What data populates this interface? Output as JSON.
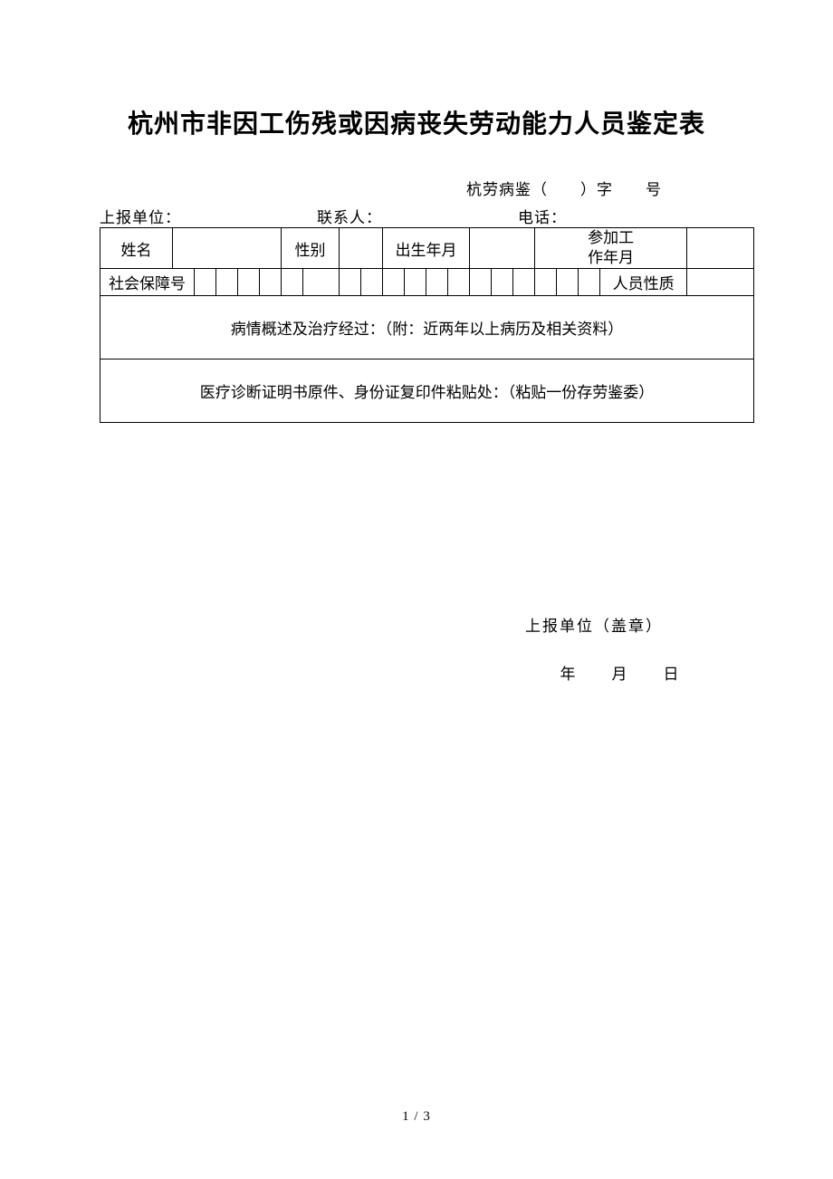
{
  "title": "杭州市非因工伤残或因病丧失劳动能力人员鉴定表",
  "docnum": "杭劳病鉴（　　）字　　号",
  "header": {
    "report_unit_label": "上报单位：",
    "contact_label": "联系人：",
    "phone_label": "电话："
  },
  "row1": {
    "name_label": "姓名",
    "gender_label": "性别",
    "birth_label": "出生年月",
    "work_date_label_l1": "参加工",
    "work_date_label_l2": "作年月"
  },
  "row2": {
    "ssn_label": "社会保障号",
    "person_type_label": "人员性质"
  },
  "section1": {
    "heading": "病情概述及治疗经过：（附：近两年以上病历及相关资料）",
    "stamp": "上报单位（盖章）",
    "year": "年",
    "month": "月",
    "day": "日"
  },
  "section2": {
    "heading": "医疗诊断证明书原件、身份证复印件粘贴处：（粘贴一份存劳鉴委）"
  },
  "footer": "1 / 3"
}
